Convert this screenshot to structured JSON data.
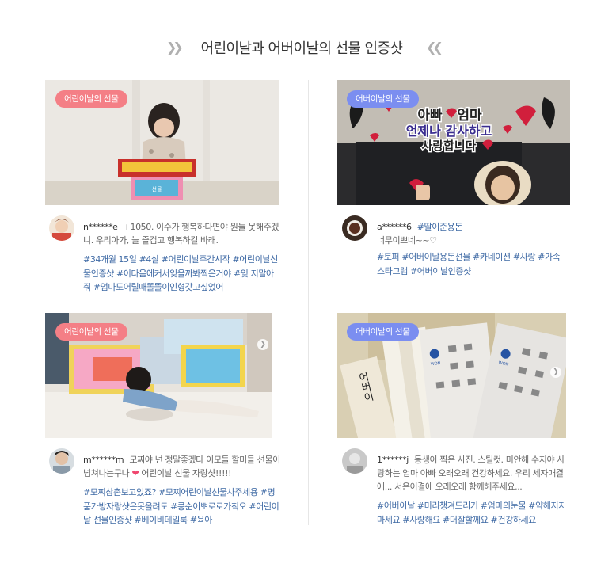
{
  "header": {
    "title": "어린이날과 어버이날의 선물 인증샷"
  },
  "colors": {
    "badge_pink": "#f47f86",
    "badge_blue": "#7b8ef0",
    "hashtag": "#3f6aa5"
  },
  "cards": [
    {
      "badge": "어린이날의 선물",
      "username": "n******e",
      "comment": "+1050. 이수가 행복하다면야 뭔들 못해주겠니. 우리아가, 늘 즐겁고 행복하길 바래.",
      "hashtags": "#34개월 15일 #4살 #어린이날주간시작 #어린이날선물인증샷 #이다음에커서잊을까봐찍은거야 #잊 지말아줘 #엄마도어릴때똘똘이인형갖고싶었어"
    },
    {
      "badge": "어버이날의 선물",
      "username": "a******6",
      "username_tag": "#딸이준용돈",
      "comment": "너무이쁘네~~♡",
      "hashtags": "#토퍼 #어버이날용돈선물 #카네이션 #사랑 #가족스타그램 #어버이날인증샷",
      "photo_text": {
        "line1": "아빠",
        "line1b": "엄마",
        "line2": "언제나 감사하고",
        "line3": "사랑합니다"
      }
    },
    {
      "badge": "어린이날의 선물",
      "username": "m******m",
      "comment_before": "모찌야 넌 정말좋겠다 이모들 할미들 선물이 넘쳐나는구나",
      "comment_after": "어린이날 선물 자랑샷!!!!!",
      "hashtags": "#모찌삼촌보고있죠? #모찌어린이날선물사주세용 #명품가방자랑샷은못올려도 #콩순이뽀로로가칙오 #어린이날 선물인증샷 #베이비데일룩 #육아"
    },
    {
      "badge": "어버이날의 선물",
      "username": "1******j",
      "comment": "동생이 찍은 사진. 스틸컷. 미안해 수지야 사랑하는 엄마 아빠 오래오래 건강하세요. 우리 세자매결에... 서은이결에 오래오래 함께해주세요...",
      "hashtags": "#어버이날 #미리챙겨드리기 #엄마의눈물 #약해지지마세요 #사랑해요 #더잘할께요 #건강하세요",
      "photo_text": {
        "won": "WON",
        "envelope": "어버이"
      }
    }
  ]
}
